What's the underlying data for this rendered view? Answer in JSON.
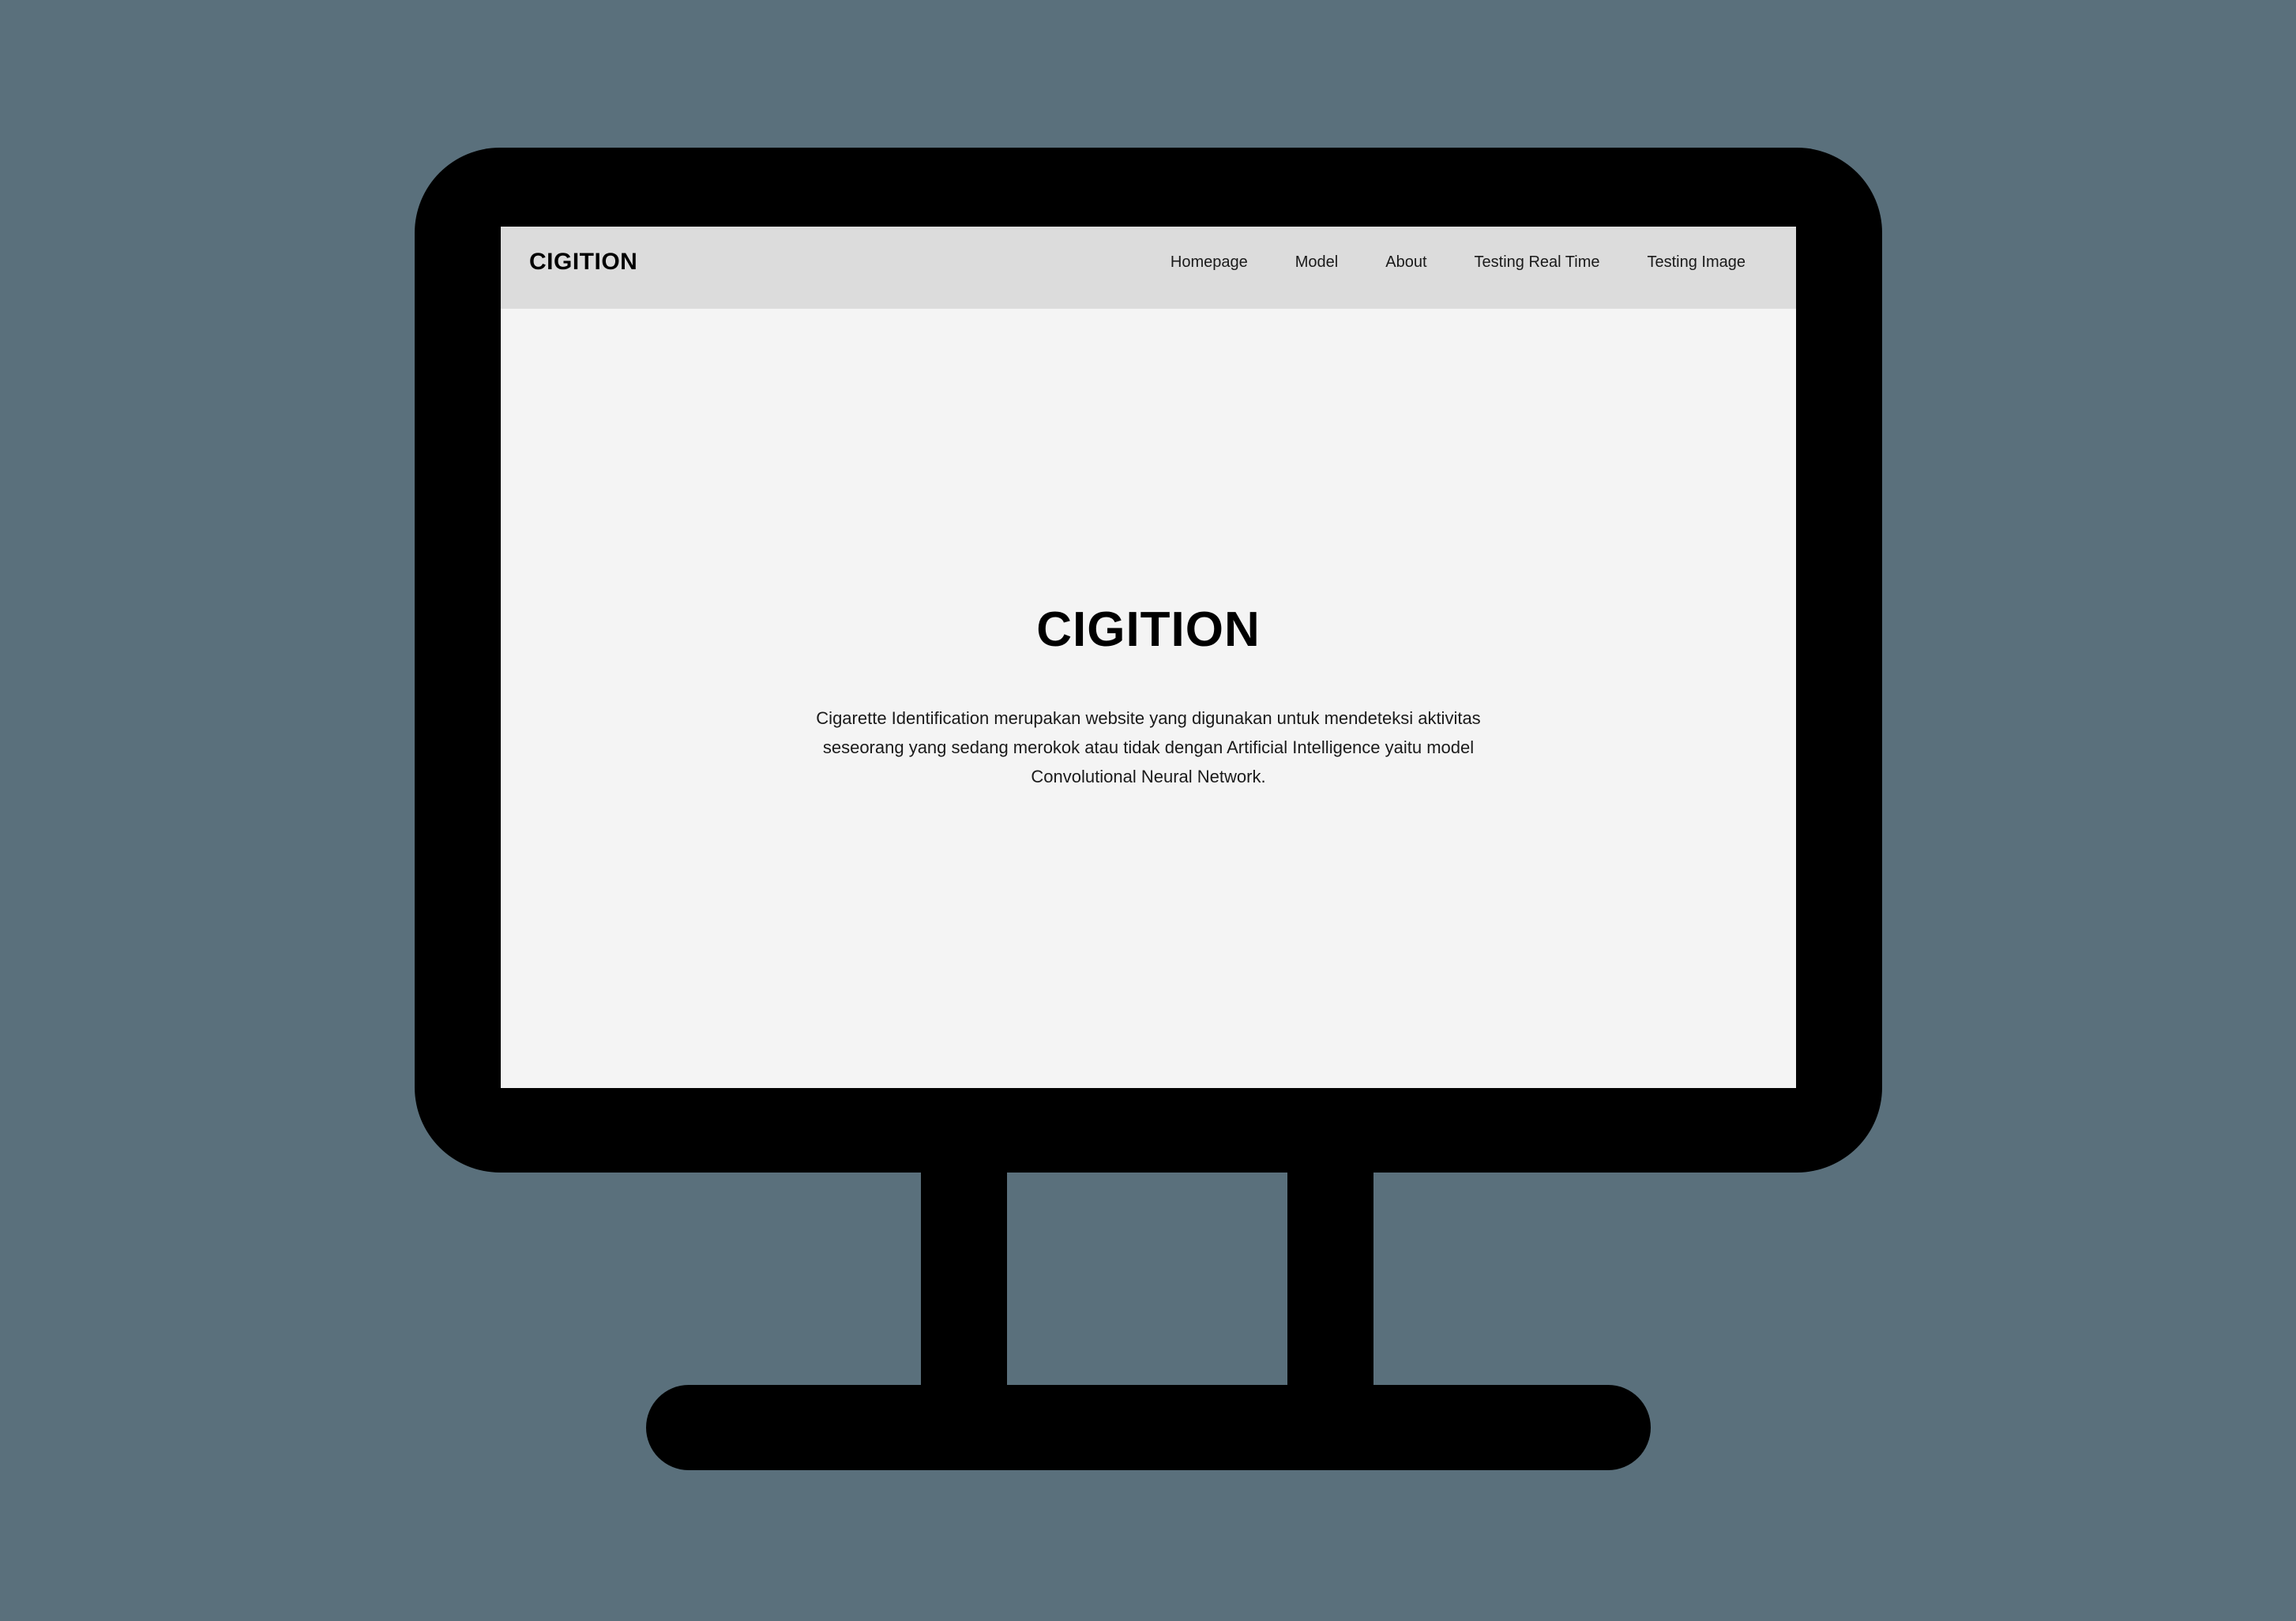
{
  "app": {
    "brand": "CIGITION"
  },
  "nav": {
    "items": [
      {
        "label": "Homepage"
      },
      {
        "label": "Model"
      },
      {
        "label": "About"
      },
      {
        "label": "Testing Real Time"
      },
      {
        "label": "Testing Image"
      }
    ]
  },
  "hero": {
    "title": "CIGITION",
    "description": "Cigarette Identification merupakan website yang digunakan untuk mendeteksi aktivitas seseorang yang sedang merokok atau tidak dengan Artificial Intelligence yaitu model Convolutional Neural Network."
  },
  "colors": {
    "background": "#5a707c",
    "monitor": "#000000",
    "navbar": "#dcdcdc",
    "screen": "#f4f4f4"
  }
}
